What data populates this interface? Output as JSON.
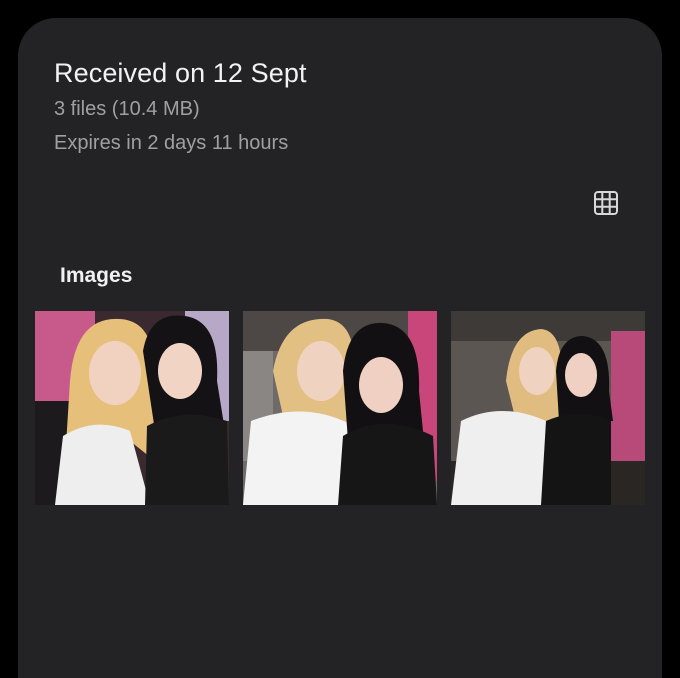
{
  "header": {
    "title": "Received on 12 Sept",
    "files_summary": "3 files (10.4 MB)",
    "expiry": "Expires in 2 days 11 hours"
  },
  "toolbar": {
    "view_toggle_icon": "grid-view-icon"
  },
  "section": {
    "title": "Images"
  },
  "images": [
    {
      "icon": "photo-thumbnail"
    },
    {
      "icon": "photo-thumbnail"
    },
    {
      "icon": "photo-thumbnail"
    }
  ],
  "colors": {
    "background": "#000000",
    "sheet": "#232325",
    "primary_text": "#f2f2f2",
    "secondary_text": "#a0a0a4"
  }
}
